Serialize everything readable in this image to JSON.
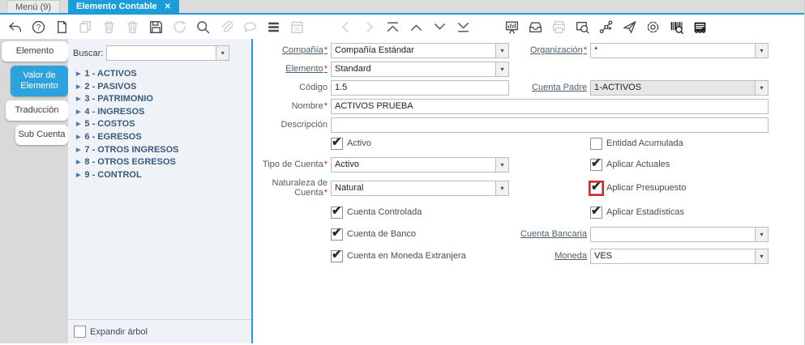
{
  "window_tabs": {
    "menu": "Menú (9)",
    "active": "Elemento Contable"
  },
  "icons": {
    "close": "✕",
    "dropdown_arrow": "▾",
    "tree_collapsed": "▶",
    "check": "✔"
  },
  "colors": {
    "accent_blue": "#1b9dd9",
    "highlight_red": "#e3251f"
  },
  "toolbar": [
    {
      "name": "undo-icon",
      "enabled": true
    },
    {
      "name": "help-icon",
      "enabled": true
    },
    {
      "name": "new-record-icon",
      "enabled": true
    },
    {
      "name": "copy-record-icon",
      "enabled": false
    },
    {
      "name": "delete-record-icon",
      "enabled": false
    },
    {
      "name": "delete-selection-icon",
      "enabled": false
    },
    {
      "name": "save-icon",
      "enabled": true
    },
    {
      "name": "refresh-icon",
      "enabled": false
    },
    {
      "name": "find-icon",
      "enabled": true
    },
    {
      "name": "attachment-icon",
      "enabled": false
    },
    {
      "name": "chat-icon",
      "enabled": false
    },
    {
      "name": "grid-toggle-icon",
      "enabled": true
    },
    {
      "name": "calendar-icon",
      "enabled": false
    },
    {
      "gap": true
    },
    {
      "name": "parent-record-icon",
      "enabled": false
    },
    {
      "name": "detail-record-icon",
      "enabled": false
    },
    {
      "name": "first-record-icon",
      "enabled": true
    },
    {
      "name": "previous-record-icon",
      "enabled": true
    },
    {
      "name": "next-record-icon",
      "enabled": true
    },
    {
      "name": "last-record-icon",
      "enabled": true
    },
    {
      "gap": true
    },
    {
      "name": "report-icon",
      "enabled": true
    },
    {
      "name": "archive-icon",
      "enabled": true
    },
    {
      "name": "print-icon",
      "enabled": false
    },
    {
      "name": "zoom-across-icon",
      "enabled": true
    },
    {
      "name": "workflow-icon",
      "enabled": true
    },
    {
      "name": "send-mail-icon",
      "enabled": true
    },
    {
      "name": "preferences-icon",
      "enabled": true
    },
    {
      "name": "barcode-icon",
      "enabled": true,
      "dark": true
    },
    {
      "name": "quick-info-icon",
      "enabled": true,
      "dark": true
    }
  ],
  "side_tabs": [
    {
      "label": "Elemento",
      "active": false,
      "indent": 2
    },
    {
      "label": "Valor de Elemento",
      "active": true,
      "indent": 13
    },
    {
      "label": "Traducción",
      "active": false,
      "indent": 7
    },
    {
      "label": "Sub Cuenta",
      "active": false,
      "indent": 19
    }
  ],
  "tree": {
    "search_label": "Buscar:",
    "items": [
      "1 - ACTIVOS",
      "2 - PASIVOS",
      "3 - PATRIMONIO",
      "4 - INGRESOS",
      "5 - COSTOS",
      "6 - EGRESOS",
      "7 - OTROS INGRESOS",
      "8 - OTROS EGRESOS",
      "9 - CONTROL"
    ],
    "expand_label": "Expandir árbol",
    "expand_checked": false
  },
  "form": {
    "compania": {
      "label": "Compañía",
      "req": "*",
      "value": "Compañía Estándar"
    },
    "organizacion": {
      "label": "Organización",
      "req": "*",
      "value": "*"
    },
    "elemento": {
      "label": "Elemento",
      "req": "*",
      "value": "Standard"
    },
    "codigo": {
      "label": "Código",
      "value": "1.5"
    },
    "cuenta_padre": {
      "label": "Cuenta Padre",
      "value": "1-ACTIVOS"
    },
    "nombre": {
      "label": "Nombre",
      "req": "*",
      "value": "ACTIVOS PRUEBA"
    },
    "descripcion": {
      "label": "Descripción",
      "value": ""
    },
    "activo": {
      "label": "Activo",
      "checked": true
    },
    "entidad_acumulada": {
      "label": "Entidad Acumulada",
      "checked": false
    },
    "tipo_cuenta": {
      "label": "Tipo de Cuenta",
      "req": "*",
      "value": "Activo"
    },
    "aplicar_actuales": {
      "label": "Aplicar Actuales",
      "checked": true
    },
    "naturaleza_cuenta": {
      "label": "Naturaleza de Cuenta",
      "req": "*",
      "value": "Natural"
    },
    "aplicar_presupuesto": {
      "label": "Aplicar Presupuesto",
      "checked": true,
      "highlighted": true
    },
    "cuenta_controlada": {
      "label": "Cuenta Controlada",
      "checked": true
    },
    "aplicar_estadisticas": {
      "label": "Aplicar Estadísticas",
      "checked": true
    },
    "cuenta_banco": {
      "label": "Cuenta de Banco",
      "checked": true
    },
    "cuenta_bancaria": {
      "label": "Cuenta Bancaria",
      "value": ""
    },
    "cuenta_moneda_extranjera": {
      "label": "Cuenta en Moneda Extranjera",
      "checked": true
    },
    "moneda": {
      "label": "Moneda",
      "value": "VES"
    }
  }
}
